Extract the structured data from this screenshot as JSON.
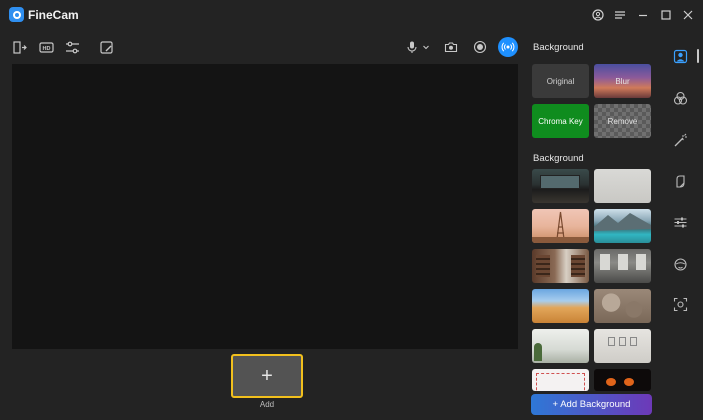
{
  "app": {
    "title": "FineCam"
  },
  "window_controls": [
    "account-icon",
    "menu-icon",
    "minimize-icon",
    "maximize-icon",
    "close-icon"
  ],
  "toolbar": {
    "left_icons": [
      "exit-icon",
      "hd-icon",
      "adjust-icon",
      "edit-icon"
    ],
    "right_icons": [
      "microphone-icon",
      "chevron-down-icon",
      "camera-icon",
      "record-icon",
      "broadcast-icon"
    ]
  },
  "add_slot": {
    "plus": "+",
    "label": "Add"
  },
  "effects": {
    "title": "Background",
    "tiles": [
      {
        "label": "Original",
        "bg": "#3a3a3a"
      },
      {
        "label": "Blur",
        "bg": "blur-sunset"
      },
      {
        "label": "Chroma Key",
        "bg": "#0f8c1e"
      },
      {
        "label": "Remove",
        "bg": "checker"
      }
    ]
  },
  "backgrounds": {
    "title": "Background",
    "thumbnails": [
      "dark-office",
      "white-wall",
      "eiffel-tower",
      "mountain-lake",
      "library-room",
      "grey-office",
      "desert-dunes",
      "rocky-ground",
      "bright-room",
      "white-gallery",
      "white-frame",
      "pumpkins"
    ]
  },
  "add_background_button": {
    "label": "+ Add Background"
  },
  "sidebar": {
    "icons": [
      "portrait-icon",
      "filter-icon",
      "magic-wand-icon",
      "sticker-icon",
      "sliders-icon",
      "face-icon",
      "scan-icon"
    ],
    "active_index": 0
  },
  "colors": {
    "accent": "#2f8ff0",
    "highlight": "#f2c01d",
    "chroma": "#0f8c1e"
  }
}
